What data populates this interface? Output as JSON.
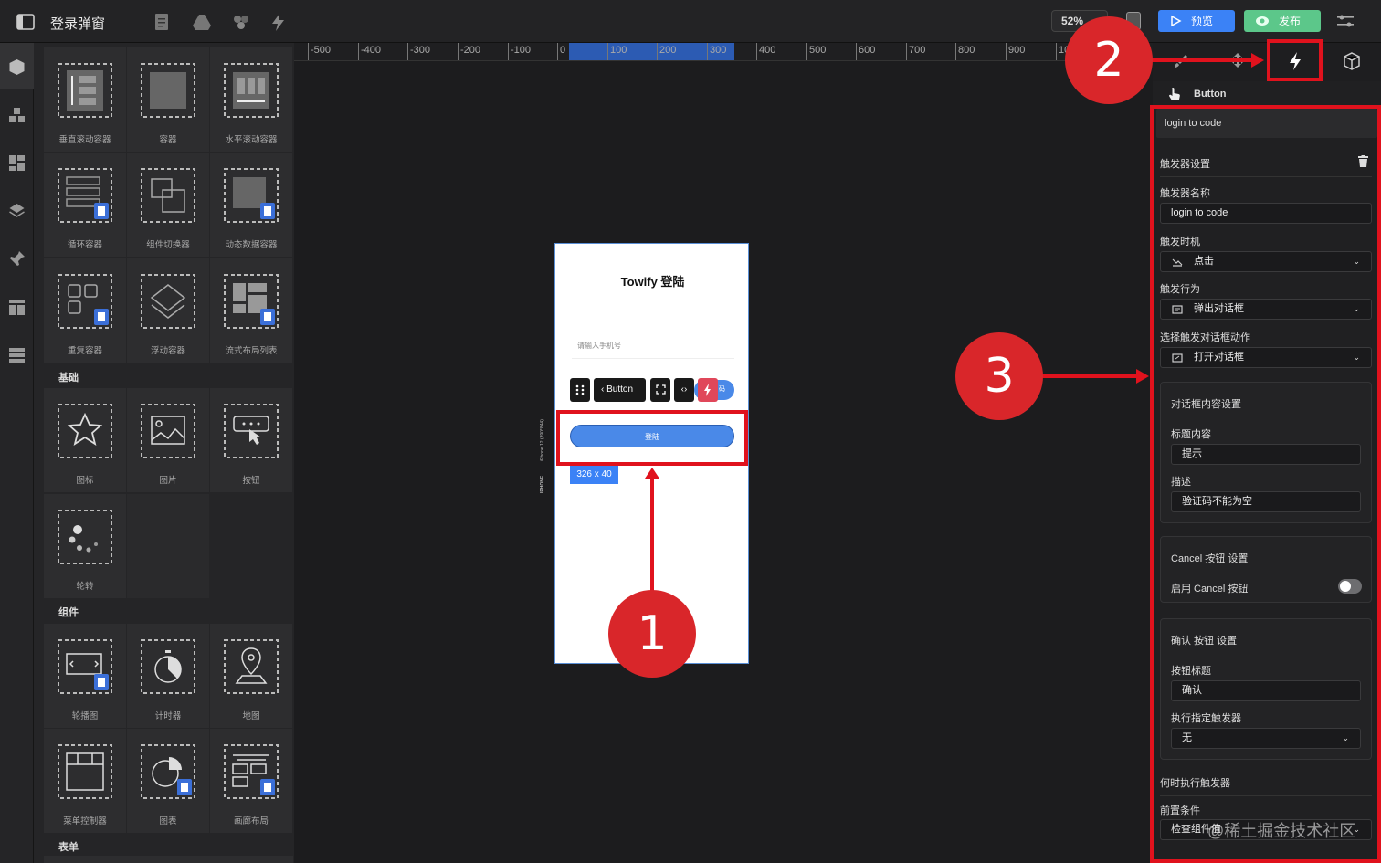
{
  "header": {
    "title": "登录弹窗",
    "zoom": "52%",
    "preview_label": "预览",
    "publish_label": "发布"
  },
  "library": {
    "row1": [
      "垂直滚动容器",
      "容器",
      "水平滚动容器"
    ],
    "row2": [
      "循环容器",
      "组件切换器",
      "动态数据容器"
    ],
    "row3": [
      "重复容器",
      "浮动容器",
      "流式布局列表"
    ],
    "section_basic": "基础",
    "basic_row1": [
      "图标",
      "图片",
      "按钮"
    ],
    "basic_row2": [
      "轮转"
    ],
    "section_components": "组件",
    "comp_row1": [
      "轮播图",
      "计时器",
      "地图"
    ],
    "comp_row2": [
      "菜单控制器",
      "图表",
      "画廊布局"
    ],
    "section_form": "表单"
  },
  "ruler": {
    "ticks": [
      "-500",
      "-400",
      "-300",
      "-200",
      "-100",
      "0",
      "100",
      "200",
      "300",
      "400",
      "500",
      "600",
      "700",
      "800",
      "900",
      "10"
    ]
  },
  "canvas": {
    "phone_title": "Towify 登陆",
    "phone_input_placeholder": "请输入手机号",
    "device_label": "iPhone 12 (390*844)",
    "device_name": "IPHONE",
    "toolbar_button_label": "Button",
    "code_button_fragment": "码",
    "login_button_label": "登陆",
    "size_tag": "326 x 40"
  },
  "annotations": {
    "step1": "1",
    "step2": "2",
    "step3": "3"
  },
  "panel": {
    "selected_component": "Button",
    "trigger_header": "login to code",
    "trigger_settings_label": "触发器设置",
    "trigger_name_label": "触发器名称",
    "trigger_name_value": "login to code",
    "trigger_timing_label": "触发时机",
    "trigger_timing_value": "点击",
    "trigger_action_label": "触发行为",
    "trigger_action_value": "弹出对话框",
    "dialog_action_label": "选择触发对话框动作",
    "dialog_action_value": "打开对话框",
    "dialog_content_label": "对话框内容设置",
    "title_content_label": "标题内容",
    "title_content_value": "提示",
    "description_label": "描述",
    "description_value": "验证码不能为空",
    "cancel_settings_label": "Cancel 按钮 设置",
    "enable_cancel_label": "启用 Cancel 按钮",
    "confirm_settings_label": "确认 按钮 设置",
    "button_title_label": "按钮标题",
    "button_title_value": "确认",
    "exec_trigger_label": "执行指定触发器",
    "exec_trigger_value": "无",
    "when_exec_label": "何时执行触发器",
    "precondition_label": "前置条件",
    "precondition_value": "检查组件值"
  },
  "watermark": "@稀土掘金技术社区",
  "colors": {
    "accent": "#3b82f6",
    "publish": "#5cc78a",
    "annotation_red": "#e0121d"
  }
}
